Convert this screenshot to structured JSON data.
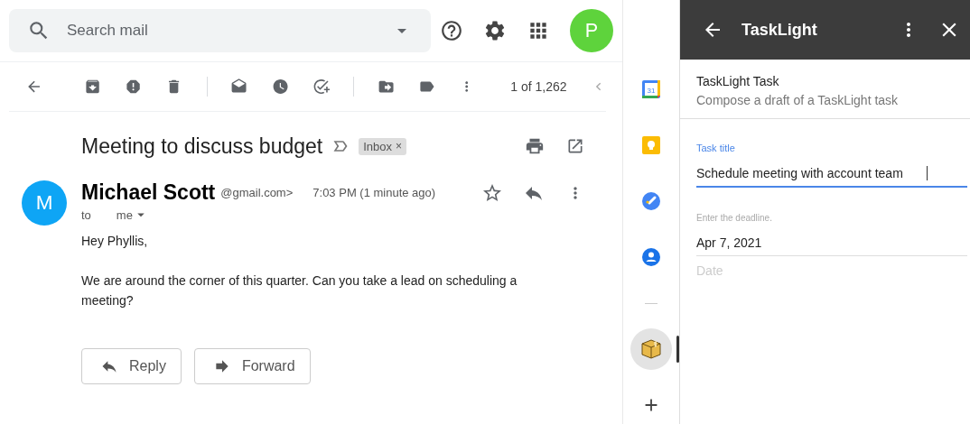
{
  "search": {
    "placeholder": "Search mail"
  },
  "account": {
    "initial": "P"
  },
  "toolbar": {
    "pager": "1 of 1,262"
  },
  "message": {
    "subject": "Meeting to discuss budget",
    "label": "Inbox",
    "label_close": "×",
    "avatar": "M",
    "sender_name": "Michael Scott",
    "sender_email": "@gmail.com>",
    "time": "7:03 PM (1 minute ago)",
    "to_prefix": "to",
    "recipient": "me",
    "body": [
      "Hey Phyllis,",
      "We are around the corner of this quarter. Can you take a lead on scheduling a meeting?"
    ]
  },
  "actions": [
    {
      "kind": "reply",
      "label": "Reply"
    },
    {
      "kind": "forward",
      "label": "Forward"
    }
  ],
  "rail": {
    "items": [
      {
        "kind": "calendar",
        "text": "31",
        "selected": false
      },
      {
        "kind": "keep",
        "selected": false
      },
      {
        "kind": "tasks",
        "selected": false
      },
      {
        "kind": "contacts",
        "selected": false
      },
      {
        "kind": "divider"
      },
      {
        "kind": "package",
        "selected": true
      },
      {
        "kind": "add",
        "selected": false
      }
    ]
  },
  "panel": {
    "title": "TaskLight",
    "card_title": "TaskLight Task",
    "card_subtitle": "Compose a draft of a TaskLight task",
    "fields": [
      {
        "label": "Task title",
        "value": "Schedule meeting with account team",
        "focused": true
      },
      {
        "label": "Enter the deadline.",
        "value": "Apr 7, 2021",
        "focused": false
      },
      {
        "placeholder": "Date"
      }
    ]
  }
}
